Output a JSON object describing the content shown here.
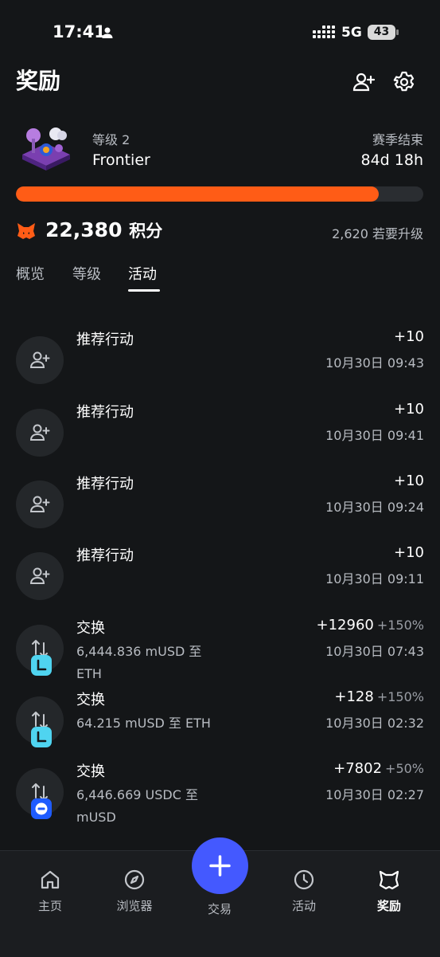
{
  "status_bar": {
    "time": "17:41",
    "network": "5G",
    "battery": "43"
  },
  "header": {
    "title": "奖励"
  },
  "level": {
    "label": "等级 2",
    "name": "Frontier",
    "season_label": "赛季结束",
    "season_remaining": "84d 18h",
    "progress": 0.89
  },
  "points": {
    "value": "22,380",
    "unit": "积分",
    "upgrade_text": "2,620 若要升级"
  },
  "tabs": [
    {
      "label": "概览"
    },
    {
      "label": "等级"
    },
    {
      "label": "活动"
    }
  ],
  "active_tab": "活动",
  "activities": [
    {
      "title": "推荐行动",
      "amount": "+10",
      "date": "10月30日 09:43",
      "icon": "user-plus-icon"
    },
    {
      "title": "推荐行动",
      "amount": "+10",
      "date": "10月30日 09:41",
      "icon": "user-plus-icon"
    },
    {
      "title": "推荐行动",
      "amount": "+10",
      "date": "10月30日 09:24",
      "icon": "user-plus-icon"
    },
    {
      "title": "推荐行动",
      "amount": "+10",
      "date": "10月30日 09:11",
      "icon": "user-plus-icon"
    },
    {
      "title": "交换",
      "subtitle": "6,444.836 mUSD 至 ETH",
      "amount": "+12960",
      "bonus": "+150%",
      "date": "10月30日 07:43",
      "icon": "swap-icon",
      "badge": "lineal-badge-icon"
    },
    {
      "title": "交换",
      "subtitle": "64.215 mUSD 至 ETH",
      "amount": "+128",
      "bonus": "+150%",
      "date": "10月30日 02:32",
      "icon": "swap-icon",
      "badge": "lineal-badge-icon"
    },
    {
      "title": "交换",
      "subtitle": "6,446.669 USDC 至 mUSD",
      "amount": "+7802",
      "bonus": "+50%",
      "date": "10月30日 02:27",
      "icon": "swap-icon",
      "badge": "blue-network-badge-icon"
    }
  ],
  "bottom_nav": [
    {
      "label": "主页",
      "icon": "home-icon"
    },
    {
      "label": "浏览器",
      "icon": "compass-icon"
    },
    {
      "label": "交易",
      "icon": "plus-icon"
    },
    {
      "label": "活动",
      "icon": "clock-icon"
    },
    {
      "label": "奖励",
      "icon": "fox-icon"
    }
  ],
  "colors": {
    "accent": "#ff5c16",
    "fab": "#4459ff",
    "background": "#141618",
    "badge_cyan": "#4fd4f0",
    "badge_blue": "#1f5cff"
  }
}
